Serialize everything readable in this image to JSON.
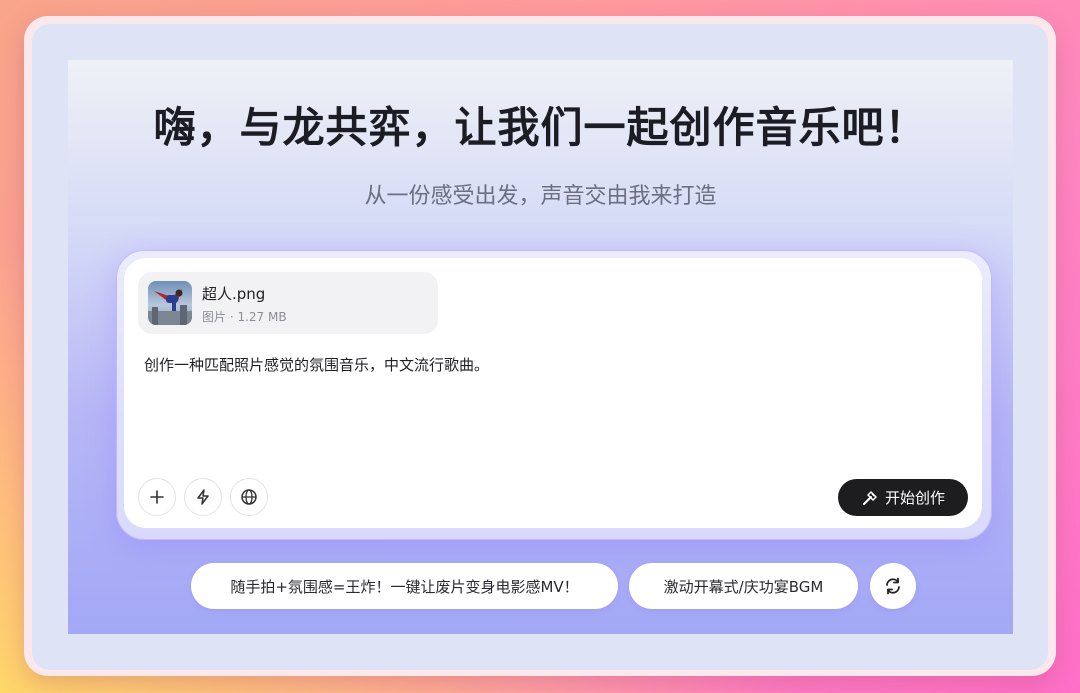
{
  "colors": {
    "primary_button": "#1d1d20",
    "card_border": "#c7b6ff",
    "headline": "#1c1c24",
    "subline": "#6b6f80"
  },
  "hero": {
    "title": "嗨，与龙共弈，让我们一起创作音乐吧！",
    "subtitle": "从一份感受出发，声音交由我来打造"
  },
  "composer": {
    "attachment": {
      "file_name": "超人.png",
      "file_meta": "图片 · 1.27 MB",
      "thumbnail_icon": "superhero-image-thumbnail"
    },
    "prompt_text": "创作一种匹配照片感觉的氛围音乐，中文流行歌曲。",
    "tools": [
      {
        "icon": "plus-icon"
      },
      {
        "icon": "lightning-icon"
      },
      {
        "icon": "globe-icon"
      }
    ],
    "start_button": {
      "label": "开始创作",
      "icon": "magic-wand-icon"
    }
  },
  "suggestions": [
    {
      "label": "随手拍+氛围感=王炸！一键让废片变身电影感MV！"
    },
    {
      "label": "激动开幕式/庆功宴BGM"
    }
  ],
  "refresh_icon": "refresh-icon"
}
